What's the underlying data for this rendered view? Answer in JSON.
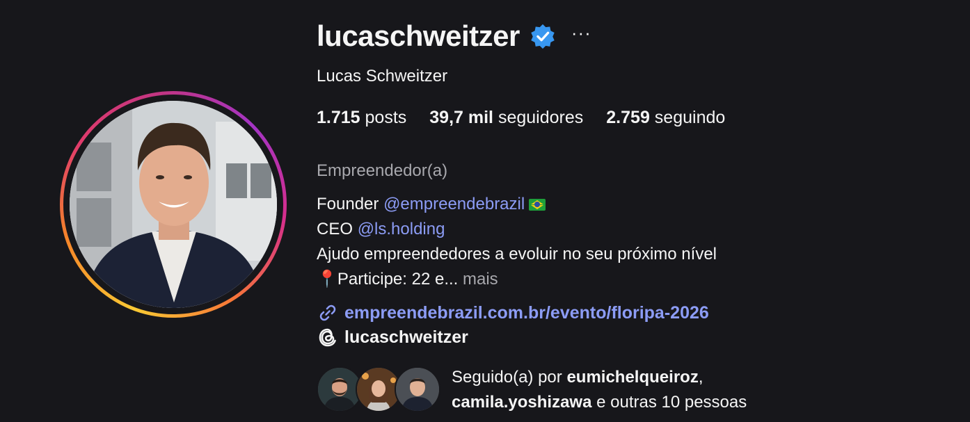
{
  "profile": {
    "username": "lucaschweitzer",
    "full_name": "Lucas Schweitzer",
    "more_label": "···",
    "stats": {
      "posts_count": "1.715",
      "posts_label": "posts",
      "followers_count": "39,7 mil",
      "followers_label": "seguidores",
      "following_count": "2.759",
      "following_label": "seguindo"
    },
    "category": "Empreendedor(a)",
    "bio": {
      "line1_prefix": "Founder",
      "line1_mention": "@empreendebrazil",
      "line2_prefix": "CEO",
      "line2_mention": "@ls.holding",
      "line3": "Ajudo empreendedores a evoluir no seu próximo nível",
      "line4_text": "Participe: 22 e...",
      "line4_more": "mais"
    },
    "link": "empreendebrazil.com.br/evento/floripa-2026",
    "threads_handle": "lucaschweitzer",
    "followed_by": {
      "prefix": "Seguido(a) por",
      "user1": "eumichelqueiroz",
      "user2": "camila.yoshizawa",
      "suffix": "e outras 10 pessoas"
    }
  },
  "colors": {
    "background": "#17171b",
    "link": "#8c9cf5",
    "verified": "#3897f0",
    "muted": "#a8a8ad"
  },
  "icons": [
    "verified-badge-icon",
    "more-icon",
    "link-icon",
    "threads-icon",
    "brazil-flag-icon",
    "pin-icon"
  ]
}
